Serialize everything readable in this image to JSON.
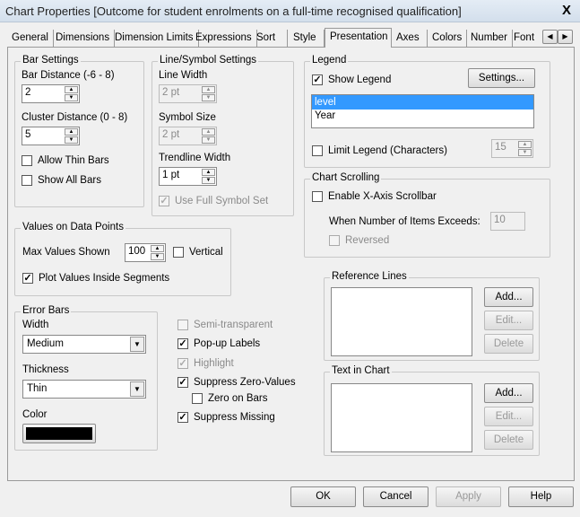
{
  "window": {
    "title": "Chart Properties [Outcome for student enrolments on a full-time recognised qualification]",
    "close": "X"
  },
  "tabs": [
    {
      "label": "General"
    },
    {
      "label": "Dimensions"
    },
    {
      "label": "Dimension Limits"
    },
    {
      "label": "Expressions"
    },
    {
      "label": "Sort"
    },
    {
      "label": "Style"
    },
    {
      "label": "Presentation",
      "active": true
    },
    {
      "label": "Axes"
    },
    {
      "label": "Colors"
    },
    {
      "label": "Number"
    },
    {
      "label": "Font"
    }
  ],
  "tab_scroll": {
    "left": "◀",
    "right": "▶"
  },
  "bar_settings": {
    "title": "Bar Settings",
    "bar_distance_label": "Bar Distance (-6 - 8)",
    "bar_distance": "2",
    "cluster_label": "Cluster Distance (0 - 8)",
    "cluster": "5",
    "allow_thin": "Allow Thin Bars",
    "show_all": "Show All Bars"
  },
  "line_symbol": {
    "title": "Line/Symbol Settings",
    "line_width_label": "Line Width",
    "line_width": "2 pt",
    "symbol_size_label": "Symbol Size",
    "symbol_size": "2 pt",
    "trend_label": "Trendline Width",
    "trend": "1 pt",
    "full_symbol": "Use Full Symbol Set"
  },
  "legend": {
    "title": "Legend",
    "show": "Show Legend",
    "settings": "Settings...",
    "items": [
      "level",
      "Year"
    ],
    "limit": "Limit Legend (Characters)",
    "limit_value": "15"
  },
  "scrolling": {
    "title": "Chart Scrolling",
    "enable": "Enable X-Axis Scrollbar",
    "exceeds_label": "When Number of Items Exceeds:",
    "exceeds": "10",
    "reversed": "Reversed"
  },
  "values": {
    "title": "Values on Data Points",
    "max_label": "Max Values Shown",
    "max": "100",
    "vertical": "Vertical",
    "inside": "Plot Values Inside Segments"
  },
  "error_bars": {
    "title": "Error Bars",
    "width_label": "Width",
    "width": "Medium",
    "thickness_label": "Thickness",
    "thickness": "Thin",
    "color_label": "Color",
    "color": "#000000"
  },
  "options": {
    "semi": "Semi-transparent",
    "popup": "Pop-up Labels",
    "highlight": "Highlight",
    "suppress_zero": "Suppress Zero-Values",
    "zero_bars": "Zero on Bars",
    "suppress_missing": "Suppress Missing"
  },
  "reference_lines": {
    "title": "Reference Lines",
    "add": "Add...",
    "edit": "Edit...",
    "delete": "Delete"
  },
  "text_in_chart": {
    "title": "Text in Chart",
    "add": "Add...",
    "edit": "Edit...",
    "delete": "Delete"
  },
  "footer": {
    "ok": "OK",
    "cancel": "Cancel",
    "apply": "Apply",
    "help": "Help"
  },
  "colors": {
    "selection": "#3399ff"
  }
}
